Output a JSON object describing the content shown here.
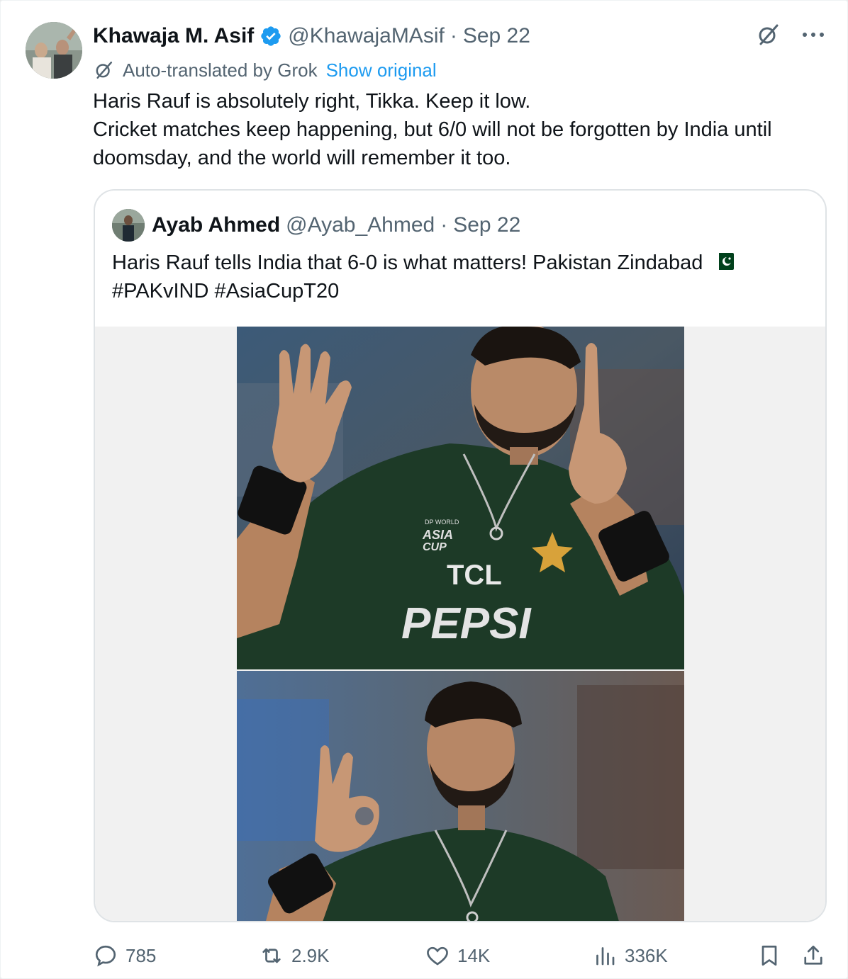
{
  "author": {
    "name": "Khawaja M. Asif",
    "handle": "@KhawajaMAsif",
    "separator": "·",
    "date": "Sep 22"
  },
  "translation": {
    "label": "Auto-translated by Grok",
    "show_original": "Show original"
  },
  "tweet": {
    "lines": [
      "Haris Rauf is absolutely right, Tikka. Keep it low.",
      "Cricket matches keep happening, but 6/0 will not be forgotten by India until",
      "doomsday, and the world will remember it too."
    ]
  },
  "quoted": {
    "name": "Ayab Ahmed",
    "handle": "@Ayab_Ahmed",
    "separator": "·",
    "date": "Sep 22",
    "lines": [
      "Haris Rauf tells India that 6-0 is what matters! Pakistan Zindabad",
      "#PAKvIND #AsiaCupT20"
    ],
    "flag_icon": "pakistan-flag-emoji",
    "photo_text": {
      "sponsor1": "TCL",
      "sponsor2": "PEPSI",
      "badge_line1": "DP WORLD",
      "badge_line2": "ASIA",
      "badge_line3": "CUP"
    }
  },
  "actions": {
    "replies": "785",
    "reposts": "2.9K",
    "likes": "14K",
    "views": "336K"
  },
  "colors": {
    "accent": "#1d9bf0",
    "muted": "#536471",
    "jersey": "#1d3a27"
  }
}
